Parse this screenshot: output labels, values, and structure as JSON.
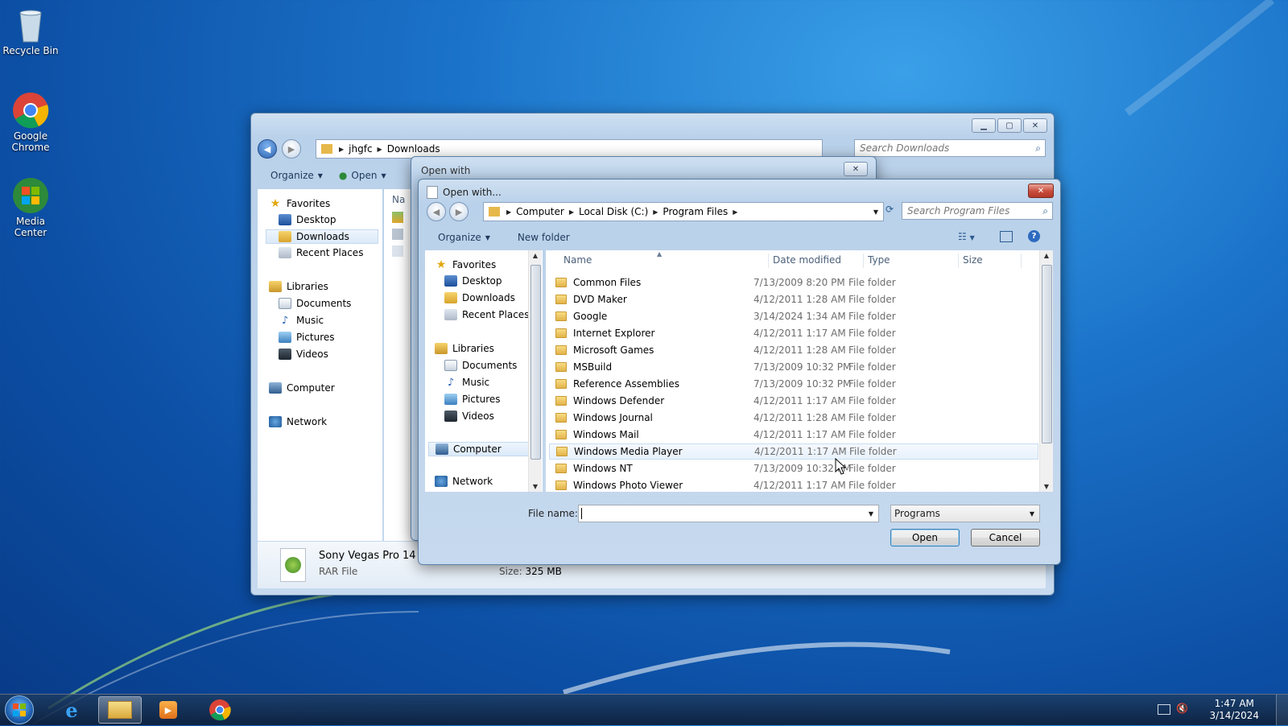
{
  "desktop": {
    "icons": [
      {
        "label": "Recycle Bin"
      },
      {
        "label": "Google Chrome"
      },
      {
        "label": "Media Center"
      }
    ]
  },
  "explorer": {
    "address": {
      "crumbs": [
        "jhgfc",
        "Downloads"
      ]
    },
    "search_placeholder": "Search Downloads",
    "toolbar": {
      "organize": "Organize",
      "open": "Open"
    },
    "name_header": "Na",
    "nav": {
      "favorites": "Favorites",
      "desktop": "Desktop",
      "downloads": "Downloads",
      "recent": "Recent Places",
      "libraries": "Libraries",
      "documents": "Documents",
      "music": "Music",
      "pictures": "Pictures",
      "videos": "Videos",
      "computer": "Computer",
      "network": "Network"
    },
    "details": {
      "title": "Sony Vegas Pro 14 -",
      "type": "RAR File",
      "size_label": "Size:",
      "size_value": "325 MB"
    }
  },
  "open_with_bg": {
    "title": "Open with"
  },
  "dialog": {
    "title": "Open with...",
    "address": {
      "crumbs": [
        "Computer",
        "Local Disk (C:)",
        "Program Files"
      ]
    },
    "search_placeholder": "Search Program Files",
    "toolbar": {
      "organize": "Organize",
      "new_folder": "New folder"
    },
    "nav": {
      "favorites": "Favorites",
      "desktop": "Desktop",
      "downloads": "Downloads",
      "recent": "Recent Places",
      "libraries": "Libraries",
      "documents": "Documents",
      "music": "Music",
      "pictures": "Pictures",
      "videos": "Videos",
      "computer": "Computer",
      "network": "Network"
    },
    "columns": {
      "name": "Name",
      "date": "Date modified",
      "type": "Type",
      "size": "Size"
    },
    "rows": [
      {
        "name": "Common Files",
        "date": "7/13/2009 8:20 PM",
        "type": "File folder"
      },
      {
        "name": "DVD Maker",
        "date": "4/12/2011 1:28 AM",
        "type": "File folder"
      },
      {
        "name": "Google",
        "date": "3/14/2024 1:34 AM",
        "type": "File folder"
      },
      {
        "name": "Internet Explorer",
        "date": "4/12/2011 1:17 AM",
        "type": "File folder"
      },
      {
        "name": "Microsoft Games",
        "date": "4/12/2011 1:28 AM",
        "type": "File folder"
      },
      {
        "name": "MSBuild",
        "date": "7/13/2009 10:32 PM",
        "type": "File folder"
      },
      {
        "name": "Reference Assemblies",
        "date": "7/13/2009 10:32 PM",
        "type": "File folder"
      },
      {
        "name": "Windows Defender",
        "date": "4/12/2011 1:17 AM",
        "type": "File folder"
      },
      {
        "name": "Windows Journal",
        "date": "4/12/2011 1:28 AM",
        "type": "File folder"
      },
      {
        "name": "Windows Mail",
        "date": "4/12/2011 1:17 AM",
        "type": "File folder"
      },
      {
        "name": "Windows Media Player",
        "date": "4/12/2011 1:17 AM",
        "type": "File folder"
      },
      {
        "name": "Windows NT",
        "date": "7/13/2009 10:32 PM",
        "type": "File folder"
      },
      {
        "name": "Windows Photo Viewer",
        "date": "4/12/2011 1:17 AM",
        "type": "File folder"
      }
    ],
    "file_name_label": "File name:",
    "file_name_value": "",
    "filter": "Programs",
    "open_button": "Open",
    "cancel_button": "Cancel"
  },
  "taskbar": {
    "time": "1:47 AM",
    "date": "3/14/2024"
  }
}
